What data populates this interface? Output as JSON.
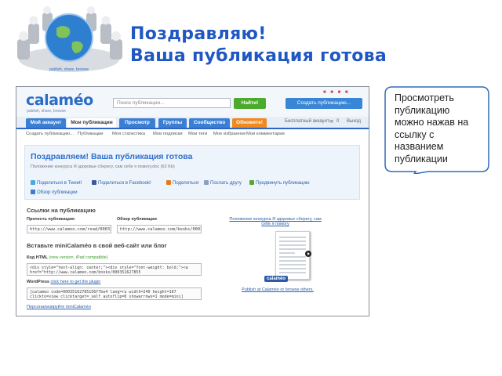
{
  "slide": {
    "title_line1": "Поздравляю!",
    "title_line2": "Ваша публикация готова",
    "globe_caption": "publish, share, browse",
    "callout_text": "Просмотреть публикацию можно нажав на ссылку с названием публикации"
  },
  "calameo": {
    "logo": "calaméo",
    "logo_sub": "publish, share, browse",
    "search_placeholder": "Поиск публикации...",
    "find_button": "Найти!",
    "create_button": "Создать публикацию...",
    "tabs": [
      "Мой аккаунт",
      "Мои публикации",
      "Просмотр",
      "Группы",
      "Сообщество",
      "Обновите!"
    ],
    "account_type": "Бесплатный аккаунт",
    "account_count": "0",
    "logout": "Выход",
    "subnav": [
      "Создать публикацию...",
      "Публикации",
      "Моя статистика",
      "Мои подписки",
      "Мои теги",
      "Мое избранное",
      "Мои комментарии"
    ],
    "congrats_title": "Поздравляем! Ваша публикация готова",
    "file_line": "Положение конкурса Я здоровье сберегу, сам себе я помогу.doc (62 Kb)",
    "share": {
      "twitter": "Поделиться в Tweet!",
      "facebook": "Поделиться в Facebook!",
      "share": "Поделиться",
      "send": "Послать другу",
      "promote": "Продвинуть публикацию"
    },
    "overview_link": "Обзор публикации",
    "links_heading": "Ссылки на публикацию",
    "read_label": "Прочесть публикацию",
    "read_url": "http://www.calameo.com/read/00033",
    "overview_label": "Обзор публикации",
    "overview_url": "http://www.calameo.com/books/0003",
    "embed_heading": "Вставьте miniCalaméo в свой веб-сайт или блог",
    "html_label": "Код HTML",
    "html_note": "(new version, iPad compatible)",
    "html_code": "<div style=\"text-align: center;\"><div style=\"font-weight: bold;\"><a href=\"http://www.calameo.com/books/000351627855",
    "wp_label": "WordPress",
    "wp_note": "click here to get the plugin",
    "wp_code": "[calameo code=00035162785156f7be4 lang=ru width=240 height=167 clickto=view clicktarget=_self autoflip=0 showarrows=1 mode=mini]",
    "personalize_link": "Персонализируйте miniCalaméo",
    "preview_title": "Положение конкурса Я здоровье сберегу, сам себе я помогу",
    "preview_logo": "calaméo",
    "preview_footer": "Publish at Calaméo or browse others."
  },
  "colors": {
    "title_blue": "#1f57c3",
    "calameo_blue": "#2a6dc9",
    "find_green": "#4caa2d",
    "upgrade_orange": "#f08a1e",
    "callout_border": "#2f6db5"
  }
}
